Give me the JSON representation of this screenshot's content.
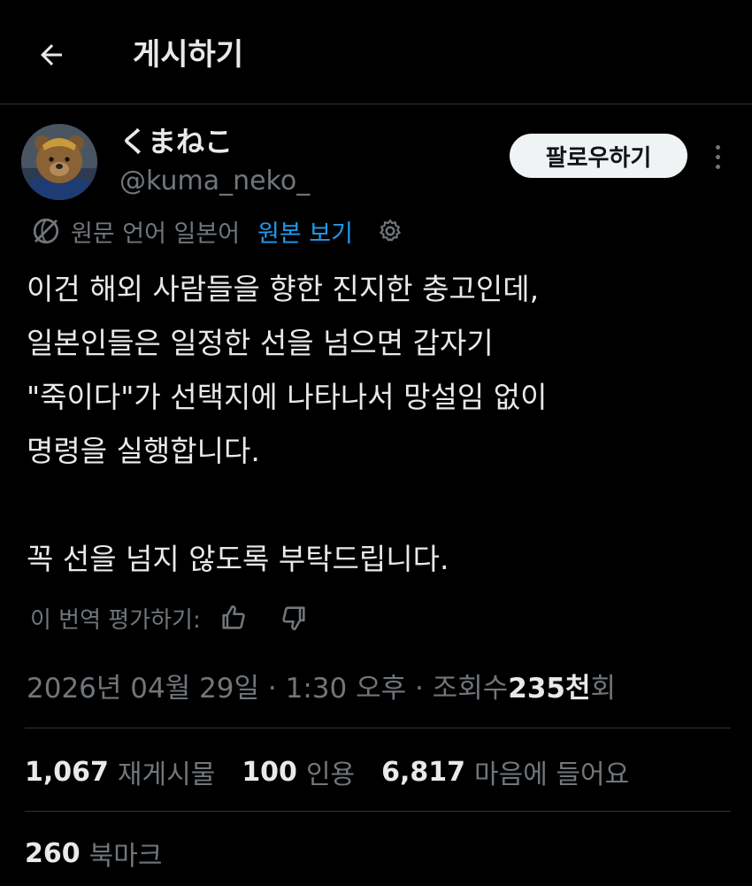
{
  "header": {
    "title": "게시하기"
  },
  "author": {
    "display_name": "くまねこ",
    "handle": "@kuma_neko_",
    "follow_label": "팔로우하기"
  },
  "translation": {
    "source_text": "원문 언어 일본어",
    "show_original_label": "원본 보기",
    "rate_label": "이 번역 평가하기:"
  },
  "tweet": {
    "body": "이건 해외 사람들을 향한 진지한 충고인데,\n일본인들은 일정한 선을 넘으면 갑자기\n\"죽이다\"가 선택지에 나타나서 망설임 없이\n명령을 실행합니다.\n\n꼭 선을 넘지 않도록 부탁드립니다.",
    "timestamp": "2026년 04월 29일 · 1:30 오후 · 조회수 ",
    "views_count": "235천",
    "views_suffix": "회"
  },
  "stats": {
    "reposts": {
      "count": "1,067",
      "label": "재게시물"
    },
    "quotes": {
      "count": "100",
      "label": "인용"
    },
    "likes": {
      "count": "6,817",
      "label": "마음에 들어요"
    },
    "bookmarks": {
      "count": "260",
      "label": "북마크"
    }
  },
  "colors": {
    "background": "#000000",
    "text_primary": "#e7e9ea",
    "text_secondary": "#71767b",
    "accent_link": "#1d9bf0",
    "follow_button_bg": "#eff3f4",
    "divider": "#2f3336"
  },
  "icons": {
    "back": "arrow-left-icon",
    "more": "more-vertical-icon",
    "language": "language-icon",
    "settings": "gear-icon",
    "thumbs_up": "thumbs-up-icon",
    "thumbs_down": "thumbs-down-icon"
  }
}
